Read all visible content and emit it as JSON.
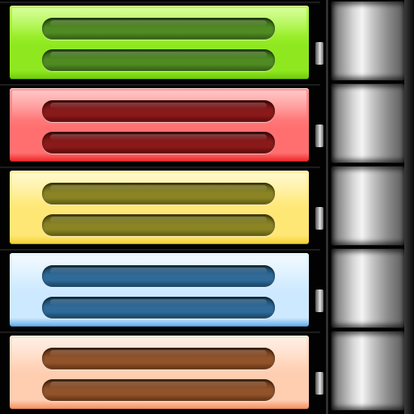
{
  "panels": [
    {
      "name": "green",
      "colors": {
        "light": "#b6ff4a",
        "mid": "#8fe81f",
        "edge": "#6fca0c",
        "slot": "#4f8a22",
        "slot_dark": "#2f5a10"
      }
    },
    {
      "name": "red",
      "colors": {
        "light": "#ff9a9a",
        "mid": "#ff6f6f",
        "edge": "#ee2222",
        "slot": "#8a1a1a",
        "slot_dark": "#560808"
      }
    },
    {
      "name": "yellow",
      "colors": {
        "light": "#fff4a6",
        "mid": "#ffe775",
        "edge": "#f3cf2c",
        "slot": "#8a8424",
        "slot_dark": "#5a560c"
      }
    },
    {
      "name": "blue",
      "colors": {
        "light": "#e6f5ff",
        "mid": "#cde9ff",
        "edge": "#5aa8e6",
        "slot": "#2f6a98",
        "slot_dark": "#15405e"
      }
    },
    {
      "name": "orange",
      "colors": {
        "light": "#ffe3d0",
        "mid": "#ffcdb0",
        "edge": "#f38d5e",
        "slot": "#91532a",
        "slot_dark": "#5e2f10"
      }
    }
  ],
  "drum_count": 5
}
